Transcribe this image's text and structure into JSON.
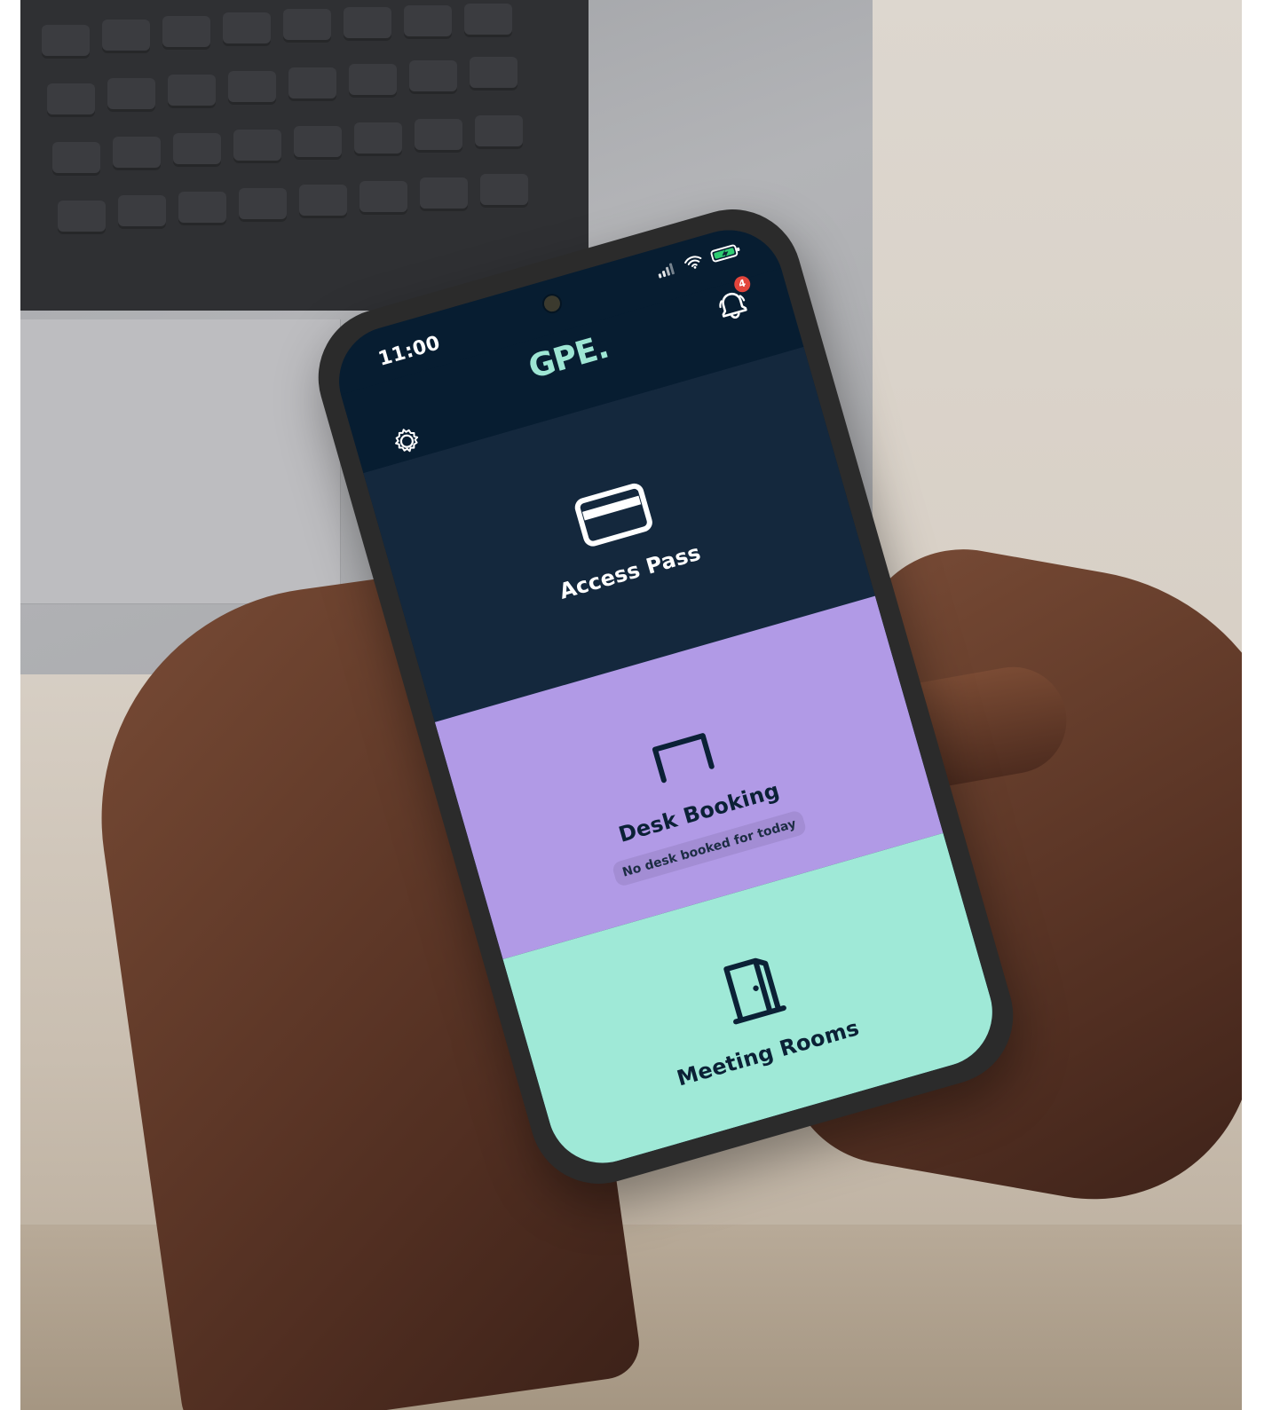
{
  "status_bar": {
    "time": "11:00"
  },
  "header": {
    "logo_text": "GPE",
    "logo_suffix": ".",
    "notifications_count": "4"
  },
  "tiles": [
    {
      "label": "Access Pass",
      "icon": "card-icon",
      "color": "#14283D"
    },
    {
      "label": "Desk Booking",
      "status": "No desk booked for today",
      "icon": "desk-icon",
      "color": "#B19AE6"
    },
    {
      "label": "Meeting Rooms",
      "icon": "door-icon",
      "color": "#9FE9D7"
    }
  ],
  "colors": {
    "header_bg": "#071D31",
    "logo": "#9EE6D4",
    "badge": "#E2453C"
  }
}
